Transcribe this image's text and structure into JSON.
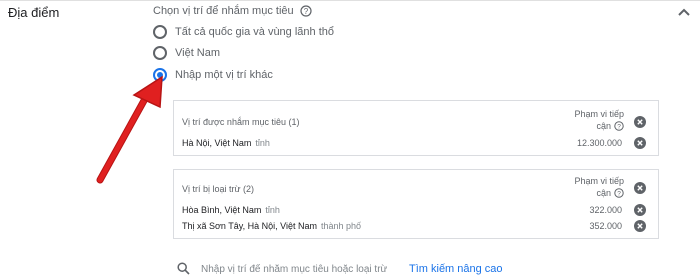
{
  "section": {
    "label": "Địa điểm"
  },
  "targeting": {
    "instruction": "Chọn vị trí để nhắm mục tiêu",
    "options": [
      {
        "label": "Tất cả quốc gia và vùng lãnh thổ",
        "checked": false
      },
      {
        "label": "Việt Nam",
        "checked": false
      },
      {
        "label": "Nhập một vị trí khác",
        "checked": true
      }
    ]
  },
  "targeted": {
    "header": "Vị trí được nhắm mục tiêu (1)",
    "reach_header_line1": "Phạm vi tiếp",
    "reach_header_line2": "cận",
    "items": [
      {
        "place": "Hà Nội, Việt Nam",
        "type": "tỉnh",
        "reach": "12.300.000"
      }
    ]
  },
  "excluded": {
    "header": "Vị trí bị loại trừ (2)",
    "reach_header_line1": "Phạm vi tiếp",
    "reach_header_line2": "cận",
    "items": [
      {
        "place": "Hòa Bình, Việt Nam",
        "type": "tỉnh",
        "reach": "322.000"
      },
      {
        "place": "Thị xã Sơn Tây, Hà Nội, Việt Nam",
        "type": "thành phố",
        "reach": "352.000"
      }
    ]
  },
  "search": {
    "placeholder": "Nhập vị trí để nhắm mục tiêu hoặc loại trừ",
    "advanced_label": "Tìm kiếm nâng cao"
  },
  "colors": {
    "accent": "#1a73e8",
    "annotation_arrow": "#e02020"
  },
  "icons": {
    "collapse": "chevron-up-icon",
    "help": "help-circle-icon",
    "remove": "remove-circle-icon",
    "search": "search-icon"
  }
}
